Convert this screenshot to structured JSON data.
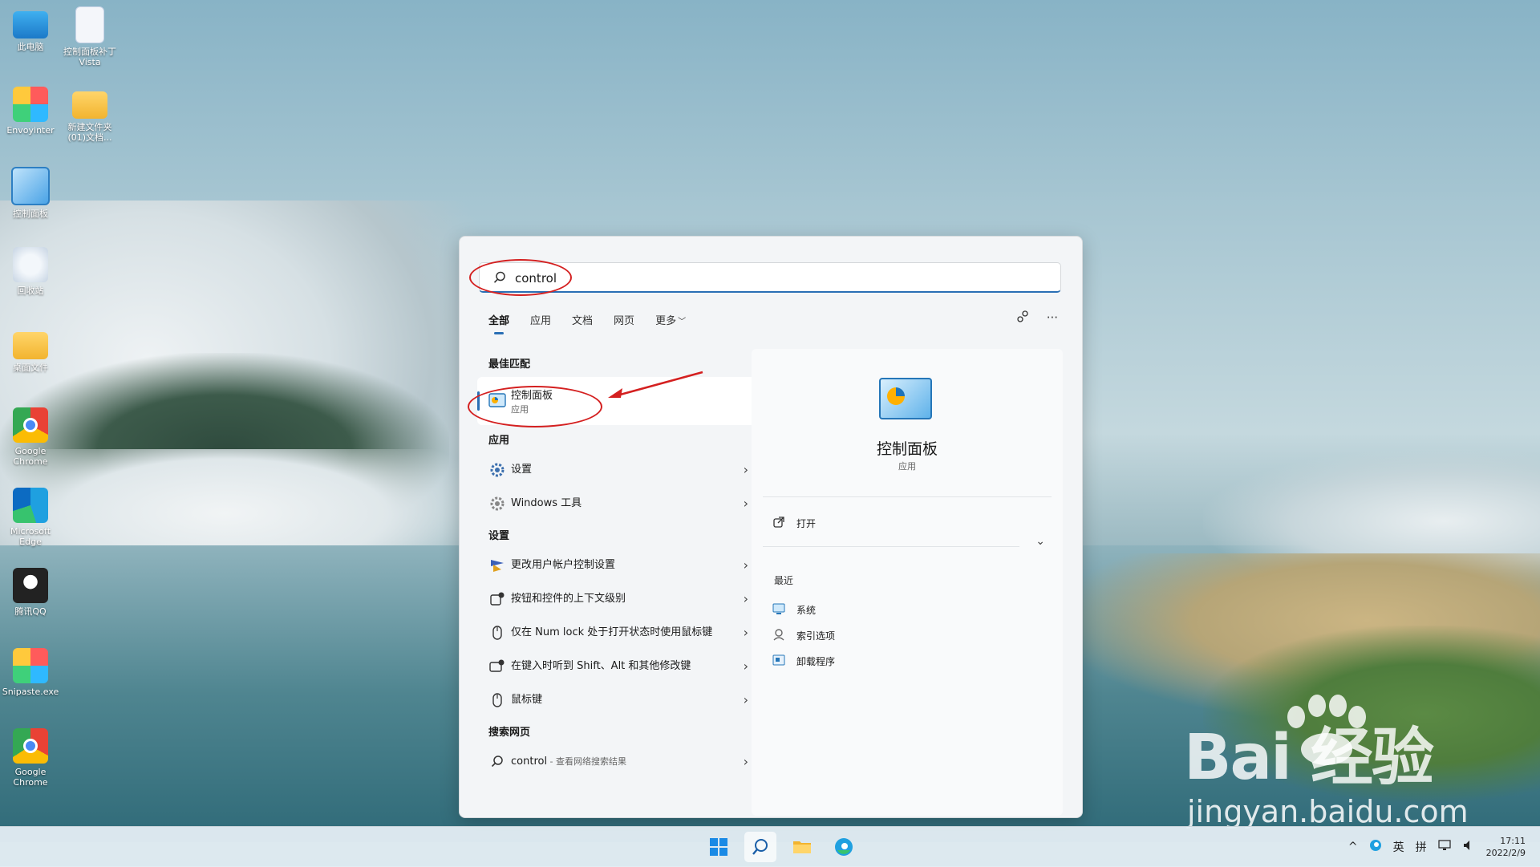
{
  "desktop": {
    "icons": [
      {
        "label": "此电脑",
        "icon": "monitor-icon"
      },
      {
        "label": "控制面板补丁 Vista",
        "icon": "document-icon"
      },
      {
        "label": "Envoyinter",
        "icon": "app-icon"
      },
      {
        "label": "新建文件夹 (01)文档...",
        "icon": "folder-icon"
      },
      {
        "label": "控制面板",
        "icon": "control-panel-icon"
      },
      {
        "label": "回收站",
        "icon": "recycle-bin-icon"
      },
      {
        "label": "桌面文件",
        "icon": "folder-icon"
      },
      {
        "label": "Google Chrome",
        "icon": "chrome-icon"
      },
      {
        "label": "Microsoft Edge",
        "icon": "edge-icon"
      },
      {
        "label": "腾讯QQ",
        "icon": "qq-icon"
      },
      {
        "label": "Snipaste.exe",
        "icon": "snipaste-icon"
      },
      {
        "label": "Google Chrome",
        "icon": "chrome-icon"
      }
    ]
  },
  "search": {
    "query": "control",
    "tabs": [
      {
        "label": "全部",
        "active": true
      },
      {
        "label": "应用",
        "active": false
      },
      {
        "label": "文档",
        "active": false
      },
      {
        "label": "网页",
        "active": false
      },
      {
        "label": "更多",
        "active": false
      }
    ],
    "actions": {
      "share_icon": "share-icon",
      "more_label": "···"
    },
    "best_match": {
      "heading": "最佳匹配",
      "title": "控制面板",
      "subtitle": "应用",
      "icon": "control-panel-icon"
    },
    "apps": {
      "heading": "应用",
      "items": [
        {
          "label": "设置",
          "icon": "gear-icon"
        },
        {
          "label": "Windows 工具",
          "icon": "tools-icon"
        }
      ]
    },
    "settings": {
      "heading": "设置",
      "items": [
        {
          "label": "更改用户帐户控制设置",
          "icon": "uac-flag-icon"
        },
        {
          "label": "按钮和控件的上下文级别",
          "icon": "context-icon"
        },
        {
          "label": "仅在 Num lock 处于打开状态时使用鼠标键",
          "icon": "mouse-icon"
        },
        {
          "label": "在键入时听到 Shift、Alt 和其他修改键",
          "icon": "keyboard-icon"
        },
        {
          "label": "鼠标键",
          "icon": "mouse-icon"
        }
      ]
    },
    "web": {
      "heading": "搜索网页",
      "item": {
        "label": "control",
        "sub": " - 查看网络搜索结果",
        "icon": "search-icon"
      }
    },
    "preview": {
      "title": "控制面板",
      "subtitle": "应用",
      "open_label": "打开",
      "recent_heading": "最近",
      "recent": [
        {
          "label": "系统",
          "icon": "system-icon"
        },
        {
          "label": "索引选项",
          "icon": "index-options-icon"
        },
        {
          "label": "卸载程序",
          "icon": "uninstall-icon"
        }
      ]
    }
  },
  "watermark": {
    "brand": "Bai  经验",
    "url": "jingyan.baidu.com"
  },
  "taskbar": {
    "apps": [
      "start-icon",
      "search-icon",
      "file-explorer-icon",
      "edge-icon"
    ],
    "tray": {
      "lang": "英",
      "ime": "拼",
      "time": "17:11",
      "date": "2022/2/9"
    }
  },
  "colors": {
    "accent": "#2a6fb5",
    "annotation_red": "#d42020"
  }
}
